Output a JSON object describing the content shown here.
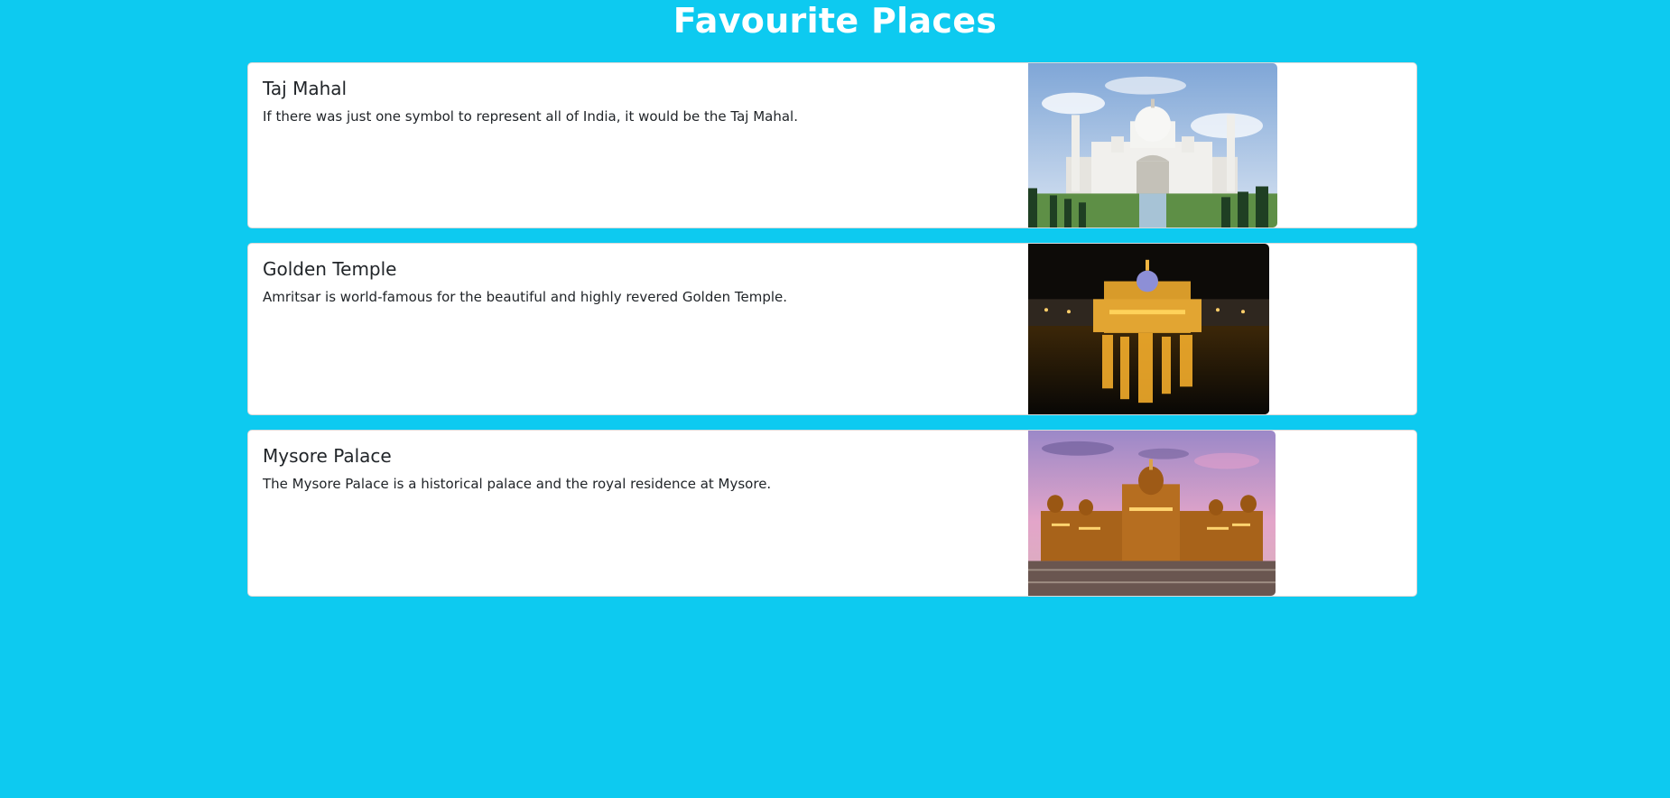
{
  "page": {
    "title": "Favourite Places"
  },
  "colors": {
    "background": "#0dcaf0",
    "card_background": "#ffffff",
    "text": "#212529",
    "title_text": "#ffffff"
  },
  "places": [
    {
      "name": "Taj Mahal",
      "description": "If there was just one symbol to represent all of India, it would be the Taj Mahal.",
      "image_icon": "taj-mahal-photo"
    },
    {
      "name": "Golden Temple",
      "description": "Amritsar is world-famous for the beautiful and highly revered Golden Temple.",
      "image_icon": "golden-temple-photo"
    },
    {
      "name": "Mysore Palace",
      "description": "The Mysore Palace is a historical palace and the royal residence at Mysore.",
      "image_icon": "mysore-palace-photo"
    }
  ]
}
